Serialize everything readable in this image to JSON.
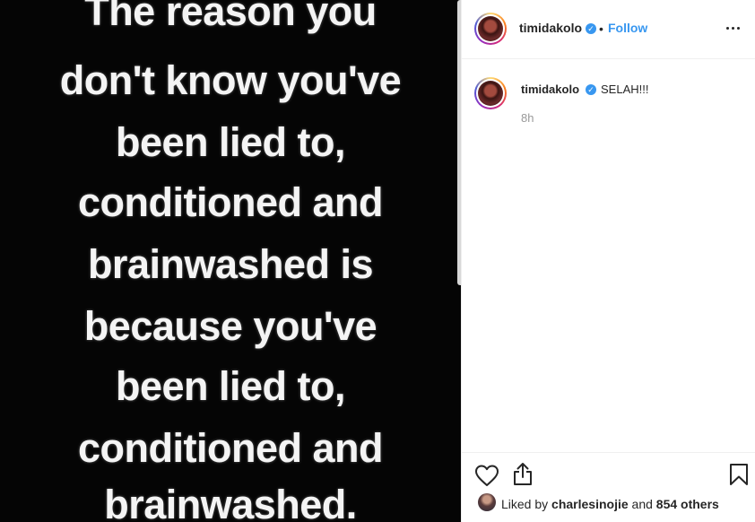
{
  "post_image": {
    "lines": [
      "The reason you",
      "don't know you've",
      "been lied to,",
      "conditioned and",
      "brainwashed is",
      "because you've",
      "been lied to,",
      "conditioned and",
      "brainwashed."
    ]
  },
  "header": {
    "username": "timidakolo",
    "separator": "•",
    "follow_label": "Follow",
    "more_icon": "more-horizontal-icon"
  },
  "caption": {
    "username": "timidakolo",
    "text": "SELAH!!!",
    "time": "8h"
  },
  "footer": {
    "liked_by_prefix": "Liked by",
    "liked_by_user": "charlesinojie",
    "liked_by_and": "and",
    "liked_by_count": "854 others"
  },
  "colors": {
    "accent": "#3897f0",
    "image_background": "#050505",
    "muted_text": "#999999"
  },
  "icons": [
    "heart-icon",
    "share-icon",
    "bookmark-icon",
    "verified-badge-icon",
    "more-horizontal-icon"
  ]
}
